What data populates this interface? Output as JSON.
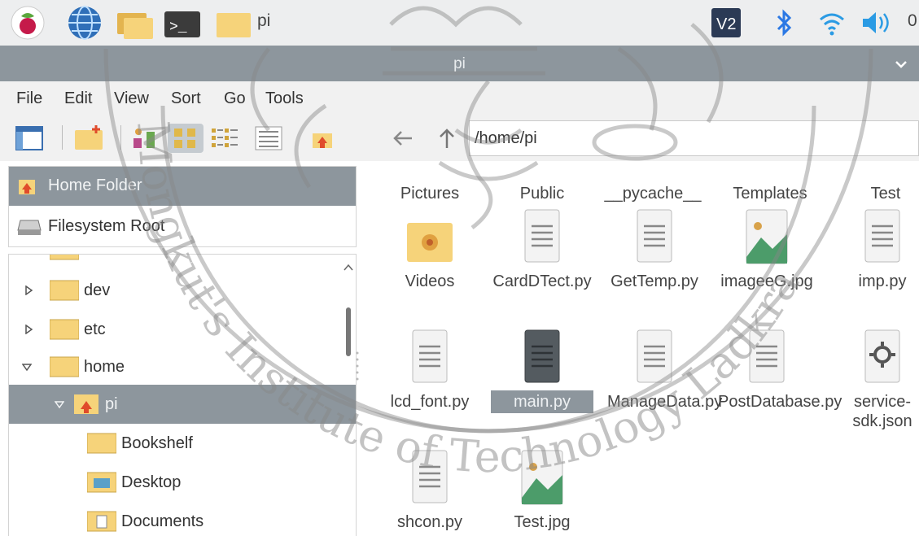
{
  "taskbar": {
    "apps": [
      {
        "icon": "raspberry-menu-icon"
      },
      {
        "icon": "web-browser-globe-icon"
      },
      {
        "icon": "file-manager-folders-icon"
      },
      {
        "icon": "terminal-icon",
        "text": ">_"
      },
      {
        "icon": "folder-task-icon"
      }
    ],
    "active_window_label": "pi",
    "tray": {
      "vnc_label": "V2",
      "bluetooth_icon": "bluetooth-icon",
      "wifi_icon": "wifi-icon",
      "volume_icon": "volume-icon",
      "clock_partial": "0"
    }
  },
  "window": {
    "title": "pi",
    "colors": {
      "titlebar": "#8d969d",
      "selection": "#8d969d",
      "folder": "#f6d37a"
    }
  },
  "menu": [
    "File",
    "Edit",
    "View",
    "Sort",
    "Go",
    "Tools"
  ],
  "toolbar": {
    "path": "/home/pi"
  },
  "places": [
    {
      "label": "Home Folder",
      "icon": "home-folder-icon",
      "selected": true
    },
    {
      "label": "Filesystem Root",
      "icon": "drive-icon",
      "selected": false
    }
  ],
  "tree": [
    {
      "label": "dev",
      "expander": "collapsed"
    },
    {
      "label": "etc",
      "expander": "collapsed"
    },
    {
      "label": "home",
      "expander": "expanded"
    },
    {
      "label": "pi",
      "expander": "expanded",
      "selected": true
    },
    {
      "label": "Bookshelf"
    },
    {
      "label": "Desktop"
    },
    {
      "label": "Documents"
    }
  ],
  "files": [
    {
      "name": "Pictures",
      "type": "folder"
    },
    {
      "name": "Public",
      "type": "folder"
    },
    {
      "name": "__pycache__",
      "type": "folder"
    },
    {
      "name": "Templates",
      "type": "folder"
    },
    {
      "name": "Test",
      "type": "folder"
    },
    {
      "name": "Videos",
      "type": "folder-video"
    },
    {
      "name": "CardDTect.py",
      "type": "text"
    },
    {
      "name": "GetTemp.py",
      "type": "text"
    },
    {
      "name": "imageeG.jpg",
      "type": "image"
    },
    {
      "name": "imp.py",
      "type": "text"
    },
    {
      "name": "lcd_font.py",
      "type": "text"
    },
    {
      "name": "main.py",
      "type": "text",
      "selected": true
    },
    {
      "name": "ManageData.py",
      "type": "text"
    },
    {
      "name": "PostDatabase.py",
      "type": "text"
    },
    {
      "name": "service-sdk.json",
      "type": "json"
    },
    {
      "name": "shcon.py",
      "type": "text"
    },
    {
      "name": "Test.jpg",
      "type": "image"
    }
  ],
  "watermark": {
    "text": "Mongkut's Institute of Technology Ladkra"
  }
}
